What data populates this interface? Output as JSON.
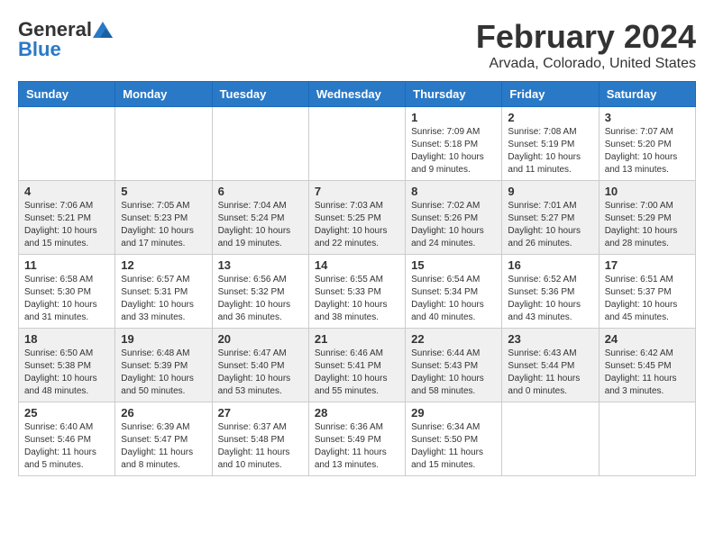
{
  "logo": {
    "general": "General",
    "blue": "Blue"
  },
  "title": "February 2024",
  "subtitle": "Arvada, Colorado, United States",
  "days_of_week": [
    "Sunday",
    "Monday",
    "Tuesday",
    "Wednesday",
    "Thursday",
    "Friday",
    "Saturday"
  ],
  "weeks": [
    [
      {
        "day": "",
        "info": ""
      },
      {
        "day": "",
        "info": ""
      },
      {
        "day": "",
        "info": ""
      },
      {
        "day": "",
        "info": ""
      },
      {
        "day": "1",
        "info": "Sunrise: 7:09 AM\nSunset: 5:18 PM\nDaylight: 10 hours\nand 9 minutes."
      },
      {
        "day": "2",
        "info": "Sunrise: 7:08 AM\nSunset: 5:19 PM\nDaylight: 10 hours\nand 11 minutes."
      },
      {
        "day": "3",
        "info": "Sunrise: 7:07 AM\nSunset: 5:20 PM\nDaylight: 10 hours\nand 13 minutes."
      }
    ],
    [
      {
        "day": "4",
        "info": "Sunrise: 7:06 AM\nSunset: 5:21 PM\nDaylight: 10 hours\nand 15 minutes."
      },
      {
        "day": "5",
        "info": "Sunrise: 7:05 AM\nSunset: 5:23 PM\nDaylight: 10 hours\nand 17 minutes."
      },
      {
        "day": "6",
        "info": "Sunrise: 7:04 AM\nSunset: 5:24 PM\nDaylight: 10 hours\nand 19 minutes."
      },
      {
        "day": "7",
        "info": "Sunrise: 7:03 AM\nSunset: 5:25 PM\nDaylight: 10 hours\nand 22 minutes."
      },
      {
        "day": "8",
        "info": "Sunrise: 7:02 AM\nSunset: 5:26 PM\nDaylight: 10 hours\nand 24 minutes."
      },
      {
        "day": "9",
        "info": "Sunrise: 7:01 AM\nSunset: 5:27 PM\nDaylight: 10 hours\nand 26 minutes."
      },
      {
        "day": "10",
        "info": "Sunrise: 7:00 AM\nSunset: 5:29 PM\nDaylight: 10 hours\nand 28 minutes."
      }
    ],
    [
      {
        "day": "11",
        "info": "Sunrise: 6:58 AM\nSunset: 5:30 PM\nDaylight: 10 hours\nand 31 minutes."
      },
      {
        "day": "12",
        "info": "Sunrise: 6:57 AM\nSunset: 5:31 PM\nDaylight: 10 hours\nand 33 minutes."
      },
      {
        "day": "13",
        "info": "Sunrise: 6:56 AM\nSunset: 5:32 PM\nDaylight: 10 hours\nand 36 minutes."
      },
      {
        "day": "14",
        "info": "Sunrise: 6:55 AM\nSunset: 5:33 PM\nDaylight: 10 hours\nand 38 minutes."
      },
      {
        "day": "15",
        "info": "Sunrise: 6:54 AM\nSunset: 5:34 PM\nDaylight: 10 hours\nand 40 minutes."
      },
      {
        "day": "16",
        "info": "Sunrise: 6:52 AM\nSunset: 5:36 PM\nDaylight: 10 hours\nand 43 minutes."
      },
      {
        "day": "17",
        "info": "Sunrise: 6:51 AM\nSunset: 5:37 PM\nDaylight: 10 hours\nand 45 minutes."
      }
    ],
    [
      {
        "day": "18",
        "info": "Sunrise: 6:50 AM\nSunset: 5:38 PM\nDaylight: 10 hours\nand 48 minutes."
      },
      {
        "day": "19",
        "info": "Sunrise: 6:48 AM\nSunset: 5:39 PM\nDaylight: 10 hours\nand 50 minutes."
      },
      {
        "day": "20",
        "info": "Sunrise: 6:47 AM\nSunset: 5:40 PM\nDaylight: 10 hours\nand 53 minutes."
      },
      {
        "day": "21",
        "info": "Sunrise: 6:46 AM\nSunset: 5:41 PM\nDaylight: 10 hours\nand 55 minutes."
      },
      {
        "day": "22",
        "info": "Sunrise: 6:44 AM\nSunset: 5:43 PM\nDaylight: 10 hours\nand 58 minutes."
      },
      {
        "day": "23",
        "info": "Sunrise: 6:43 AM\nSunset: 5:44 PM\nDaylight: 11 hours\nand 0 minutes."
      },
      {
        "day": "24",
        "info": "Sunrise: 6:42 AM\nSunset: 5:45 PM\nDaylight: 11 hours\nand 3 minutes."
      }
    ],
    [
      {
        "day": "25",
        "info": "Sunrise: 6:40 AM\nSunset: 5:46 PM\nDaylight: 11 hours\nand 5 minutes."
      },
      {
        "day": "26",
        "info": "Sunrise: 6:39 AM\nSunset: 5:47 PM\nDaylight: 11 hours\nand 8 minutes."
      },
      {
        "day": "27",
        "info": "Sunrise: 6:37 AM\nSunset: 5:48 PM\nDaylight: 11 hours\nand 10 minutes."
      },
      {
        "day": "28",
        "info": "Sunrise: 6:36 AM\nSunset: 5:49 PM\nDaylight: 11 hours\nand 13 minutes."
      },
      {
        "day": "29",
        "info": "Sunrise: 6:34 AM\nSunset: 5:50 PM\nDaylight: 11 hours\nand 15 minutes."
      },
      {
        "day": "",
        "info": ""
      },
      {
        "day": "",
        "info": ""
      }
    ]
  ]
}
